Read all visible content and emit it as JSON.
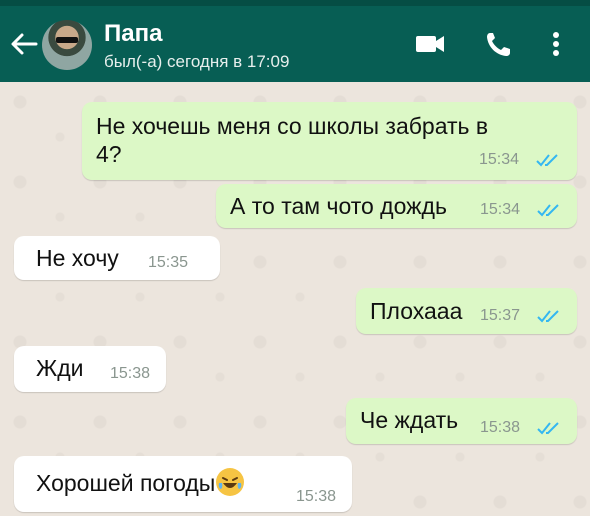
{
  "header": {
    "contact_name": "Папа",
    "last_seen": "был(-а) сегодня в 17:09",
    "icons": [
      "back-arrow-icon",
      "avatar",
      "video-call-icon",
      "phone-icon",
      "more-vert-icon"
    ]
  },
  "colors": {
    "header": "#075e54",
    "outgoing_bubble": "#dcf8c6",
    "incoming_bubble": "#ffffff",
    "read_ticks": "#34b7f1",
    "background": "#ece5dd"
  },
  "messages": [
    {
      "direction": "outgoing",
      "lines": [
        "Не хочешь меня со школы забрать в",
        "4?"
      ],
      "time": "15:34",
      "read": true
    },
    {
      "direction": "outgoing",
      "text": "А то там чото дождь",
      "time": "15:34",
      "read": true
    },
    {
      "direction": "incoming",
      "text": "Не хочу",
      "time": "15:35"
    },
    {
      "direction": "outgoing",
      "text": "Плохааа",
      "time": "15:37",
      "read": true
    },
    {
      "direction": "incoming",
      "text": "Жди",
      "time": "15:38"
    },
    {
      "direction": "outgoing",
      "text": "Че ждать",
      "time": "15:38",
      "read": true
    },
    {
      "direction": "incoming",
      "text": "Хорошей погоды",
      "emoji": "laughing-with-tears-emoji",
      "time": "15:38"
    }
  ]
}
